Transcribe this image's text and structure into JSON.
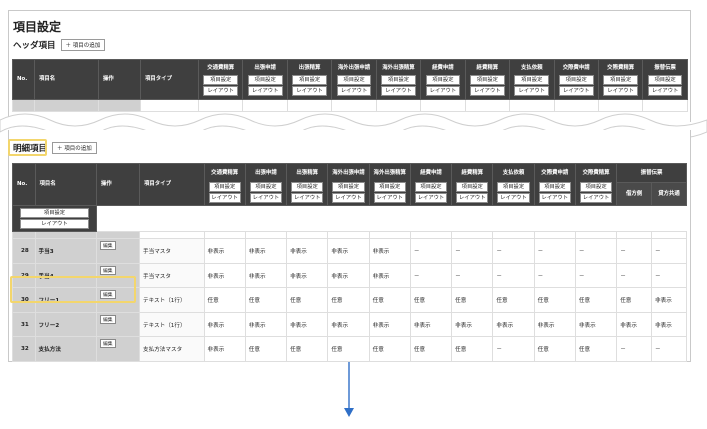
{
  "page_title": "項目設定",
  "header_section": {
    "title": "ヘッダ項目",
    "add_button": "＋ 項目の追加",
    "fixed_headers": [
      "No.",
      "項目名",
      "操作",
      "項目タイプ"
    ],
    "columns": [
      "交通費精算",
      "出張申請",
      "出張精算",
      "海外出張申請",
      "海外出張精算",
      "経費申請",
      "経費精算",
      "支払依頼",
      "交際費申請",
      "交際費精算",
      "振替伝票"
    ],
    "item_setting_label": "項目設定",
    "layout_label": "レイアウト"
  },
  "detail_section": {
    "title": "明細項目",
    "add_button": "＋ 項目の追加",
    "fixed_headers": [
      "No.",
      "項目名",
      "操作",
      "項目タイプ"
    ],
    "columns": [
      "交通費精算",
      "出張申請",
      "出張精算",
      "海外出張申請",
      "海外出張精算",
      "経費申請",
      "経費精算",
      "支払依頼",
      "交際費申請",
      "交際費精算"
    ],
    "group_column": {
      "label": "振替伝票",
      "sub": [
        "借方側",
        "貸方共通"
      ]
    },
    "item_setting_label": "項目設定",
    "layout_label": "レイアウト",
    "edit_label": "編集",
    "rows": [
      {
        "no": "28",
        "name": "手当3",
        "type": "手当マスタ",
        "values": [
          "非表示",
          "非表示",
          "非表示",
          "非表示",
          "非表示",
          "－",
          "－",
          "－",
          "－",
          "－",
          "－",
          "－"
        ]
      },
      {
        "no": "29",
        "name": "手当4",
        "type": "手当マスタ",
        "values": [
          "非表示",
          "非表示",
          "非表示",
          "非表示",
          "非表示",
          "－",
          "－",
          "－",
          "－",
          "－",
          "－",
          "－"
        ]
      },
      {
        "no": "30",
        "name": "フリー1",
        "type": "テキスト（1行）",
        "values": [
          "任意",
          "任意",
          "任意",
          "任意",
          "任意",
          "任意",
          "任意",
          "任意",
          "任意",
          "任意",
          "任意",
          "非表示"
        ]
      },
      {
        "no": "31",
        "name": "フリー2",
        "type": "テキスト（1行）",
        "values": [
          "非表示",
          "非表示",
          "非表示",
          "非表示",
          "非表示",
          "非表示",
          "非表示",
          "非表示",
          "非表示",
          "非表示",
          "非表示",
          "非表示"
        ]
      },
      {
        "no": "32",
        "name": "支払方法",
        "type": "支払方法マスタ",
        "values": [
          "非表示",
          "任意",
          "任意",
          "任意",
          "任意",
          "任意",
          "任意",
          "－",
          "任意",
          "任意",
          "－",
          "－"
        ]
      }
    ]
  }
}
